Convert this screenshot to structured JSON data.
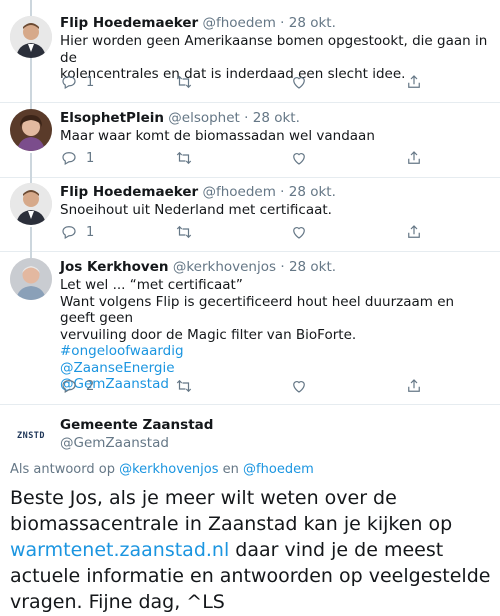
{
  "tweets": [
    {
      "name": "Flip Hoedemaeker",
      "handle": "@fhoedem",
      "date": "28 okt.",
      "lines": [
        "Hier worden geen Amerikaanse bomen opgestookt, die gaan in de",
        "kolencentrales en dat is inderdaad een slecht idee."
      ],
      "links": [],
      "replies": "1",
      "retweets": "",
      "likes": ""
    },
    {
      "name": "ElsophetPlein",
      "handle": "@elsophet",
      "date": "28 okt.",
      "lines": [
        "Maar waar komt de biomassadan wel vandaan"
      ],
      "links": [],
      "replies": "1",
      "retweets": "",
      "likes": ""
    },
    {
      "name": "Flip Hoedemaeker",
      "handle": "@fhoedem",
      "date": "28 okt.",
      "lines": [
        "Snoeihout uit Nederland met certificaat."
      ],
      "links": [],
      "replies": "1",
      "retweets": "",
      "likes": ""
    },
    {
      "name": "Jos Kerkhoven",
      "handle": "@kerkhovenjos",
      "date": "28 okt.",
      "lines": [
        "Let wel ... “met certificaat”",
        "Want volgens Flip is gecertificeerd hout heel duurzaam en geeft geen",
        "vervuiling door de Magic filter van BioForte."
      ],
      "links": [
        "#ongeloofwaardig",
        "@ZaanseEnergie",
        "@GemZaanstad"
      ],
      "replies": "2",
      "retweets": "",
      "likes": ""
    }
  ],
  "focus": {
    "logo_text": "ZNSTD",
    "name": "Gemeente Zaanstad",
    "handle": "@GemZaanstad",
    "reply_prefix": "Als antwoord op",
    "reply_user1": "@kerkhovenjos",
    "reply_and": "en",
    "reply_user2": "@fhoedem",
    "text_part1": "Beste Jos, als je meer wilt weten over de biomassacentrale in Zaanstad kan je kijken op ",
    "text_link": "warmtenet.zaanstad.nl",
    "text_part2": " daar vind je de meest actuele informatie en antwoorden op veelgestelde vragen. Fijne dag,  ^LS"
  },
  "colors": {
    "link": "#1b95e0",
    "muted": "#657786",
    "divider": "#e6ecf0"
  },
  "icons": [
    "reply-icon",
    "retweet-icon",
    "like-icon",
    "share-icon"
  ]
}
